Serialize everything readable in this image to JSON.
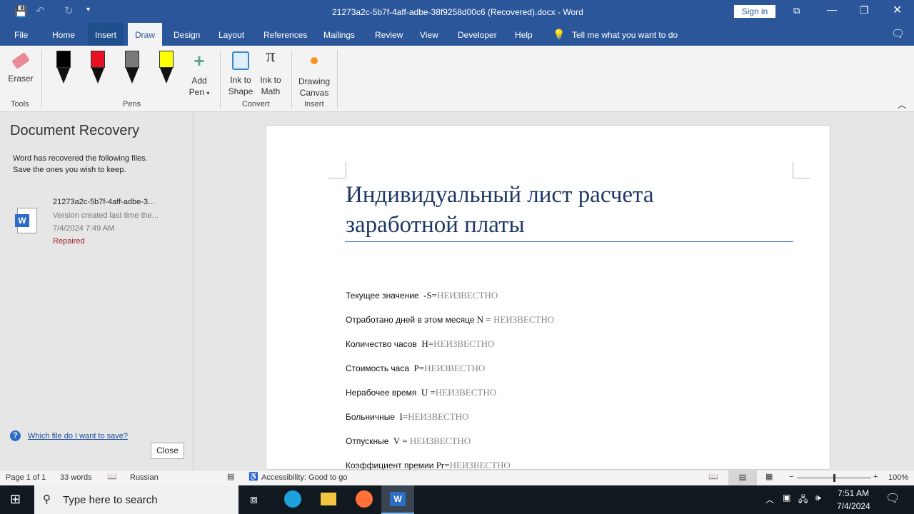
{
  "titlebar": {
    "title": "21273a2c-5b7f-4aff-adbe-38f9258d00c6 (Recovered).docx  -  Word",
    "sign_in": "Sign in"
  },
  "tabs": [
    "File",
    "Home",
    "Insert",
    "Draw",
    "Design",
    "Layout",
    "References",
    "Mailings",
    "Review",
    "View",
    "Developer",
    "Help"
  ],
  "tell_me": "Tell me what you want to do",
  "ribbon": {
    "eraser": "Eraser",
    "tools": "Tools",
    "pens": "Pens",
    "add_pen_1": "Add",
    "add_pen_2": "Pen",
    "ink_shape_1": "Ink to",
    "ink_shape_2": "Shape",
    "ink_math_1": "Ink to",
    "ink_math_2": "Math",
    "convert": "Convert",
    "canvas_1": "Drawing",
    "canvas_2": "Canvas",
    "insert": "Insert"
  },
  "pens": [
    {
      "color": "#000000"
    },
    {
      "color": "#e81123"
    },
    {
      "color": "#7a7a7a"
    },
    {
      "color": "#ffff00"
    }
  ],
  "recovery": {
    "title": "Document Recovery",
    "desc_1": "Word has recovered the following files.",
    "desc_2": "Save the ones you wish to keep.",
    "file_name": "21273a2c-5b7f-4aff-adbe-3...",
    "file_desc": "Version created last time the...",
    "file_date": "7/4/2024 7:49 AM",
    "file_status": "Repaired",
    "help_link": "Which file do I want to save?",
    "close": "Close"
  },
  "document": {
    "title_1": "Индивидуальный лист расчета",
    "title_2": "заработной платы",
    "lines": [
      {
        "label": "Текущее значение",
        "key": "  -S=",
        "value": "НЕИЗВЕСТНО"
      },
      {
        "label": "Отработано дней в этом месяце",
        "key": " N = ",
        "value": "НЕИЗВЕСТНО"
      },
      {
        "label": "Количество часов",
        "key": "  H=",
        "value": "НЕИЗВЕСТНО"
      },
      {
        "label": "Стоимость часа",
        "key": "  P=",
        "value": "НЕИЗВЕСТНО"
      },
      {
        "label": "Нерабочее время",
        "key": "  U =",
        "value": "НЕИЗВЕСТНО"
      },
      {
        "label": "Больничные",
        "key": "  I=",
        "value": "НЕИЗВЕСТНО"
      },
      {
        "label": "Отпускные",
        "key": "  V = ",
        "value": "НЕИЗВЕСТНО"
      },
      {
        "label": "Коэффициент премии",
        "key": " Pr=",
        "value": "НЕИЗВЕСТНО"
      }
    ]
  },
  "status": {
    "page": "Page 1 of 1",
    "words": "33 words",
    "language": "Russian",
    "accessibility": "Accessibility: Good to go",
    "zoom": "100%"
  },
  "taskbar": {
    "search_placeholder": "Type here to search",
    "time": "7:51 AM",
    "date": "7/4/2024"
  }
}
